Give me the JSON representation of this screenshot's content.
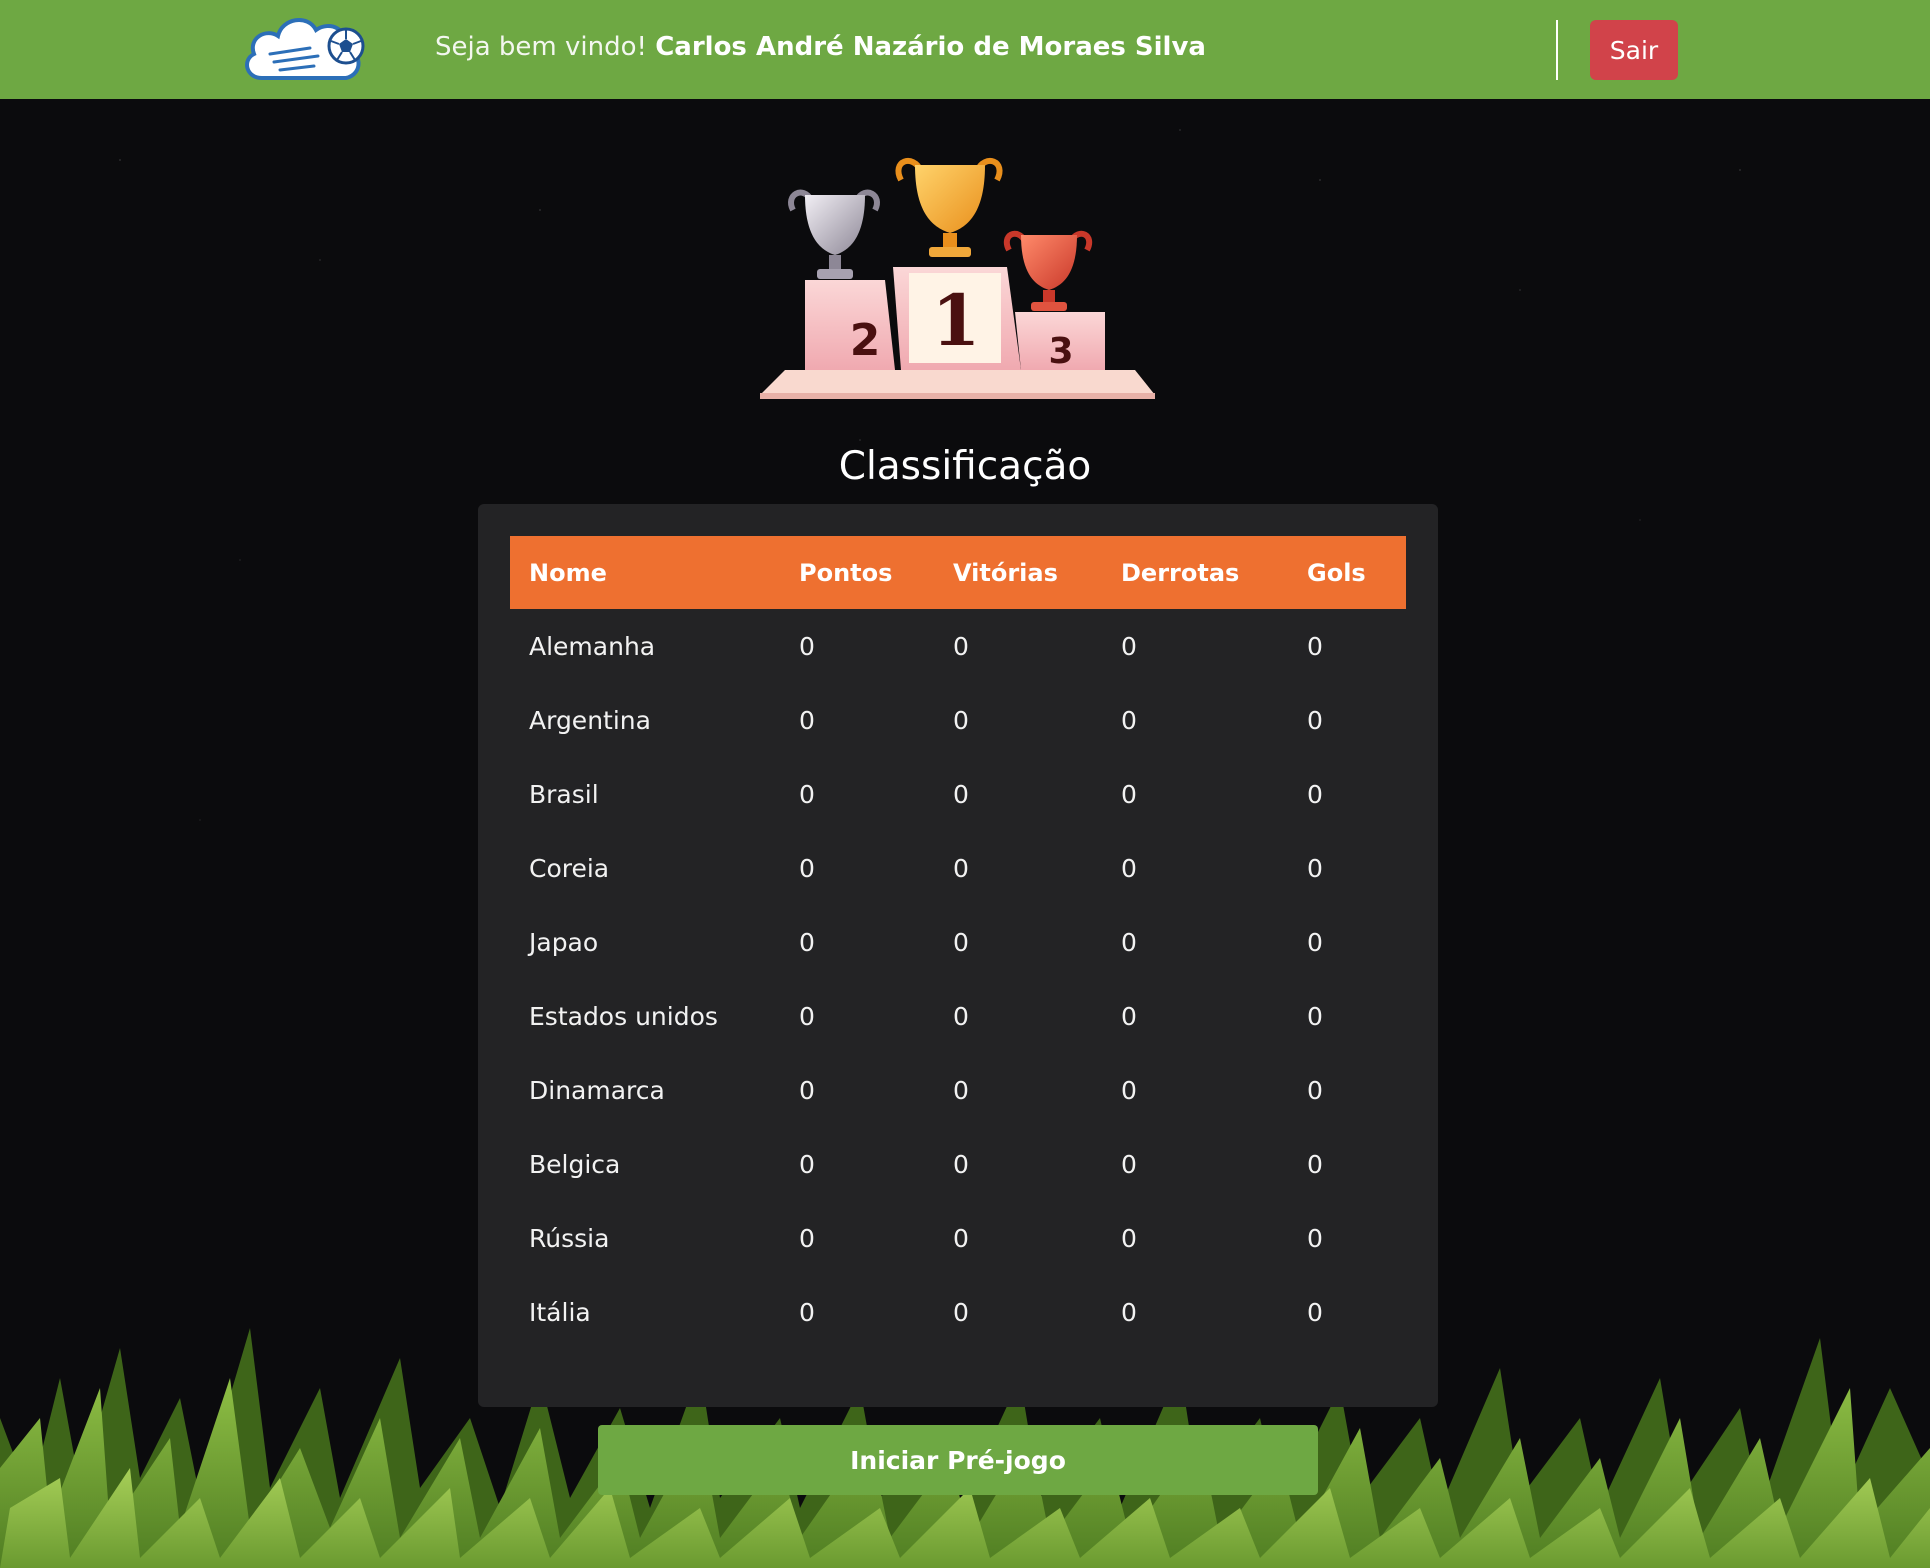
{
  "header": {
    "welcome_prefix": "Seja bem vindo!",
    "username": "Carlos André Nazário de Moraes Silva",
    "logout_label": "Sair",
    "logo_icon": "cloud-soccer-ball-logo-icon"
  },
  "colors": {
    "header_bg": "#6ea843",
    "logout_bg": "#d1434a",
    "table_header_bg": "#ee7030",
    "card_bg": "#232325",
    "page_bg": "#0b0b0d",
    "start_button_bg": "#6ea843"
  },
  "podium": {
    "icon": "trophy-podium-icon",
    "places": [
      "2",
      "1",
      "3"
    ]
  },
  "main": {
    "title": "Classificação",
    "table": {
      "columns": [
        "Nome",
        "Pontos",
        "Vitórias",
        "Derrotas",
        "Gols"
      ],
      "rows": [
        [
          "Alemanha",
          "0",
          "0",
          "0",
          "0"
        ],
        [
          "Argentina",
          "0",
          "0",
          "0",
          "0"
        ],
        [
          "Brasil",
          "0",
          "0",
          "0",
          "0"
        ],
        [
          "Coreia",
          "0",
          "0",
          "0",
          "0"
        ],
        [
          "Japao",
          "0",
          "0",
          "0",
          "0"
        ],
        [
          "Estados unidos",
          "0",
          "0",
          "0",
          "0"
        ],
        [
          "Dinamarca",
          "0",
          "0",
          "0",
          "0"
        ],
        [
          "Belgica",
          "0",
          "0",
          "0",
          "0"
        ],
        [
          "Rússia",
          "0",
          "0",
          "0",
          "0"
        ],
        [
          "Itália",
          "0",
          "0",
          "0",
          "0"
        ]
      ]
    },
    "start_button_label": "Iniciar Pré-jogo"
  }
}
